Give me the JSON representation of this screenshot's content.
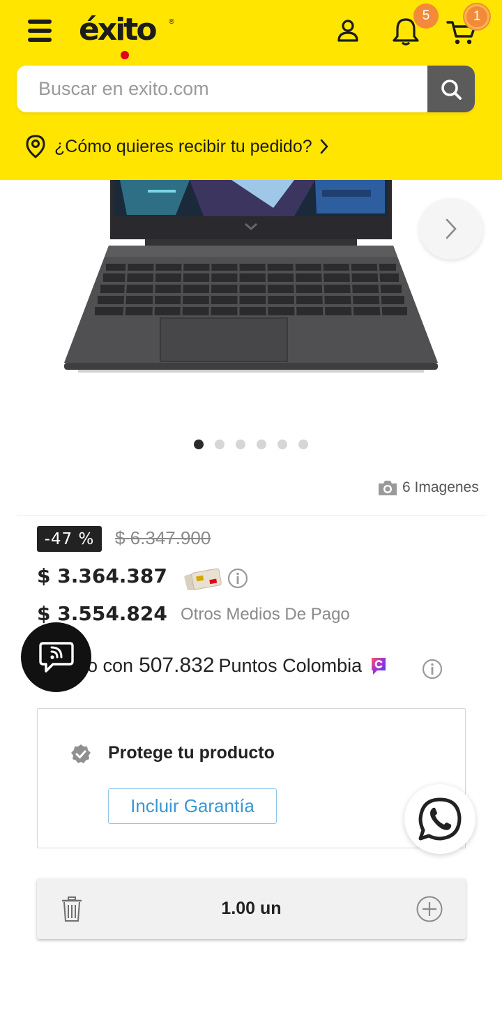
{
  "header": {
    "logo_text": "éxito",
    "logo_registered": "®",
    "notifications_count": "5",
    "cart_count": "1",
    "colors": {
      "background": "#ffe500",
      "badge": "#f28a3a",
      "logo_dot": "#e3001b"
    }
  },
  "search": {
    "placeholder": "Buscar en exito.com",
    "icons": {
      "search": "search-icon"
    }
  },
  "delivery": {
    "label": "¿Cómo quieres recibir tu pedido?"
  },
  "gallery": {
    "total_dots": 6,
    "active_index": 0,
    "images_label": "6 Imagenes"
  },
  "pricing": {
    "discount": "-47 %",
    "old_price": "$ 6.347.900",
    "card_price": "$ 3.364.387",
    "other_price": "$ 3.554.824",
    "other_label": "Otros Medios De Pago",
    "points_prefix": "o con",
    "points_value": "507.832",
    "points_brand": "Puntos Colombia"
  },
  "warranty": {
    "title": "Protege tu producto",
    "button_label": "Incluir Garantía",
    "accent": "#3b97d3"
  },
  "quantity": {
    "value": "1.00 un"
  }
}
